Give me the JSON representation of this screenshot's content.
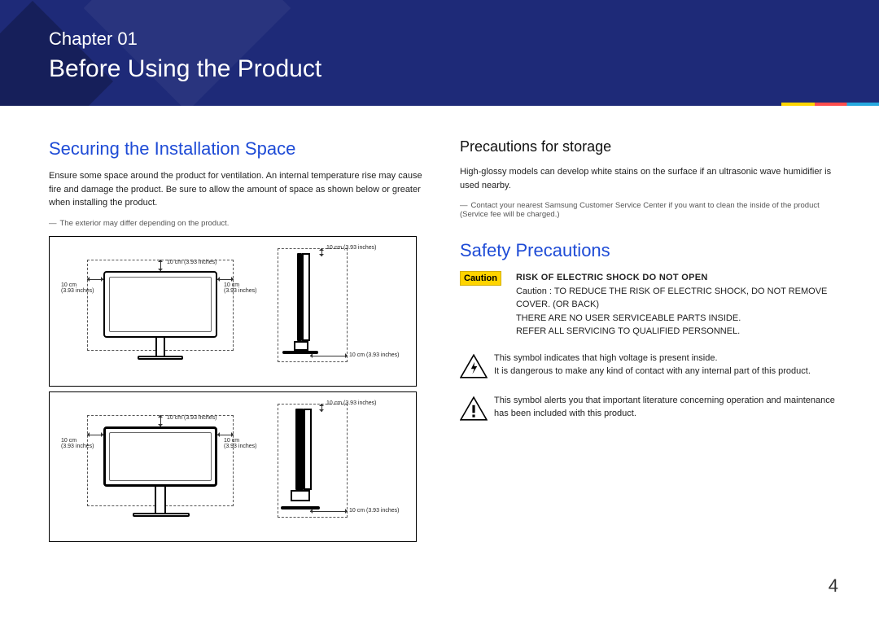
{
  "banner": {
    "chapter": "Chapter 01",
    "title": "Before Using the Product"
  },
  "left": {
    "heading": "Securing the Installation Space",
    "text": "Ensure some space around the product for ventilation. An internal temperature rise may cause fire and damage the product. Be sure to allow the amount of space as shown below or greater when installing the product.",
    "note": "The exterior may differ depending on the product."
  },
  "right": {
    "ps_heading": "Precautions for storage",
    "ps_text": "High-glossy models can develop white stains on the surface if an ultrasonic wave humidifier is used nearby.",
    "ps_note": "Contact your nearest Samsung Customer Service Center if you want to clean the inside of the product (Service fee will be charged.)",
    "sp_heading": "Safety Precautions",
    "caution_label": "Caution",
    "caution_title": "RISK OF ELECTRIC SHOCK DO NOT OPEN",
    "caution_body": "Caution : TO REDUCE THE RISK OF ELECTRIC SHOCK, DO NOT REMOVE COVER. (OR BACK)\nTHERE ARE NO USER SERVICEABLE PARTS INSIDE.\nREFER ALL SERVICING TO QUALIFIED PERSONNEL.",
    "sym1": "This symbol indicates that high voltage is present inside.\nIt is dangerous to make any kind of contact with any internal part of this product.",
    "sym2": "This symbol alerts you that important literature concerning operation and maintenance has been included with this product."
  },
  "dim": {
    "ten": "10 cm (3.93 inches)",
    "ten_two": "10 cm\n(3.93 inches)"
  },
  "page_number": "4"
}
